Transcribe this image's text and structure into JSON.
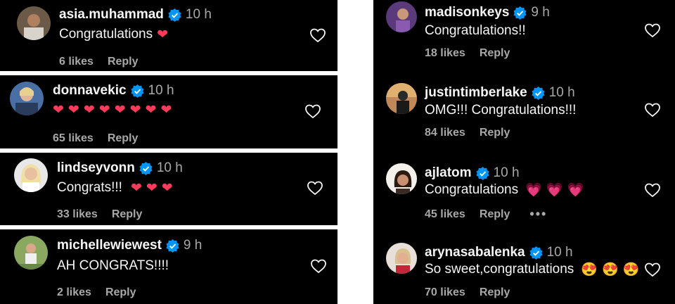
{
  "comments_left": [
    {
      "username": "asia.muhammad",
      "time": "10 h",
      "text": "Congratulations",
      "emojis": [
        "❤"
      ],
      "emoji_style": "red-heart",
      "likes": "6 likes",
      "reply": "Reply"
    },
    {
      "username": "donnavekic",
      "time": "10 h",
      "text": "",
      "emojis": [
        "❤",
        "❤",
        "❤",
        "❤",
        "❤",
        "❤",
        "❤",
        "❤"
      ],
      "emoji_style": "red-heart",
      "likes": "65 likes",
      "reply": "Reply"
    },
    {
      "username": "lindseyvonn",
      "time": "10 h",
      "text": "Congrats!!!",
      "emojis": [
        "❤",
        "❤",
        "❤"
      ],
      "emoji_style": "red-heart",
      "likes": "33 likes",
      "reply": "Reply"
    },
    {
      "username": "michellewiewest",
      "time": "9 h",
      "text": "AH CONGRATS!!!!",
      "emojis": [],
      "emoji_style": "red-heart",
      "likes": "2 likes",
      "reply": "Reply"
    }
  ],
  "comments_right": [
    {
      "username": "madisonkeys",
      "time": "9 h",
      "text": "Congratulations!!",
      "emojis": [],
      "emoji_style": "red-heart",
      "likes": "18 likes",
      "reply": "Reply",
      "more": ""
    },
    {
      "username": "justintimberlake",
      "time": "10 h",
      "text": "OMG!!! Congratulations!!!",
      "emojis": [],
      "emoji_style": "red-heart",
      "likes": "84 likes",
      "reply": "Reply",
      "more": ""
    },
    {
      "username": "ajlatom",
      "time": "10 h",
      "text": "Congratulations",
      "emojis": [
        "💗",
        "💗",
        "💗"
      ],
      "emoji_style": "pink-heart",
      "likes": "45 likes",
      "reply": "Reply",
      "more": "•••"
    },
    {
      "username": "arynasabalenka",
      "time": "10 h",
      "text": "So sweet,congratulations",
      "emojis": [
        "😍",
        "😍",
        "😍"
      ],
      "emoji_style": "face",
      "likes": "70 likes",
      "reply": "Reply",
      "more": ""
    }
  ],
  "colors": {
    "background": "#000000",
    "text": "#f5f5f5",
    "muted": "#a8a8a8",
    "verified": "#0095f6",
    "heart": "#ff3b5c"
  }
}
